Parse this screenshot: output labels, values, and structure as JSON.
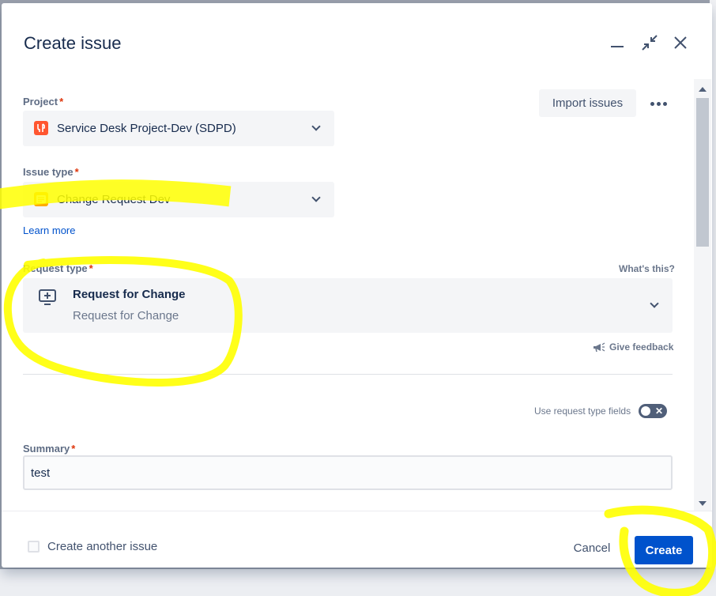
{
  "dialog": {
    "title": "Create issue"
  },
  "header_actions": {
    "minimize_icon": "minimize-icon",
    "collapse_icon": "collapse-icon",
    "close_icon": "close-icon"
  },
  "project": {
    "label": "Project",
    "required_mark": "*",
    "value": "Service Desk Project-Dev (SDPD)",
    "icon": "project-avatar-icon"
  },
  "toolbar": {
    "import_label": "Import issues",
    "more_icon": "more-icon"
  },
  "issue_type": {
    "label": "Issue type",
    "required_mark": "*",
    "value": "Change Request Dev",
    "icon": "change-request-icon",
    "learn_more": "Learn more"
  },
  "request_type": {
    "label": "Request type",
    "required_mark": "*",
    "help_link": "What's this?",
    "title": "Request for Change",
    "description": "Request for Change",
    "icon": "monitor-plus-icon",
    "feedback": "Give feedback"
  },
  "request_fields_toggle": {
    "label": "Use request type fields",
    "enabled": false
  },
  "summary": {
    "label": "Summary",
    "required_mark": "*",
    "value": "test"
  },
  "footer": {
    "create_another_label": "Create another issue",
    "cancel_label": "Cancel",
    "create_label": "Create"
  },
  "colors": {
    "primary": "#0052cc",
    "highlight": "#ffff00",
    "required": "#de350b",
    "project_icon": "#ff5630",
    "issue_icon": "#ffab00"
  }
}
